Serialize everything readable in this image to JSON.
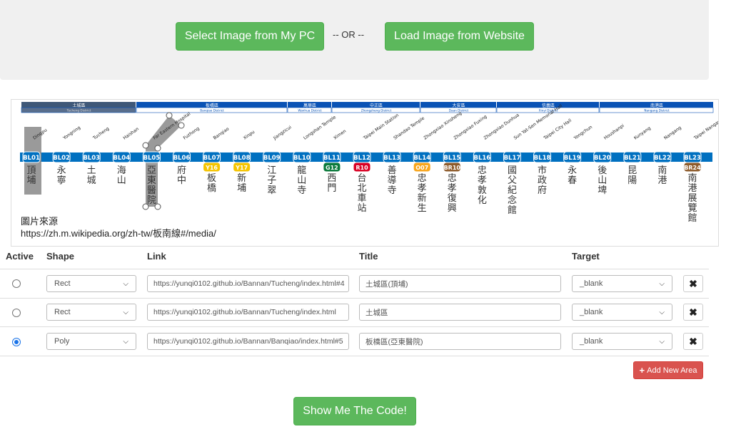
{
  "toolbar": {
    "select_pc_label": "Select Image from My PC",
    "or_label": "-- OR --",
    "load_web_label": "Load Image from Website",
    "show_code_label": "Show Me The Code!"
  },
  "map": {
    "districts": [
      {
        "name": "土城區",
        "en": "Tucheng District",
        "highlight": true
      },
      {
        "name": "板橋區",
        "en": "Banqiao District",
        "highlight": false
      },
      {
        "name": "萬華區",
        "en": "Wanhua District",
        "highlight": false
      },
      {
        "name": "中正區",
        "en": "Zhongzheng District",
        "highlight": false
      },
      {
        "name": "大安區",
        "en": "Daan District",
        "highlight": false
      },
      {
        "name": "信義區",
        "en": "Xinyi District",
        "highlight": false
      },
      {
        "name": "南港區",
        "en": "Nangang District",
        "highlight": false
      }
    ],
    "stations": [
      {
        "code": "BL01",
        "zh": "頂埔",
        "en": "Dingpu"
      },
      {
        "code": "BL02",
        "zh": "永寧",
        "en": "Yongning"
      },
      {
        "code": "BL03",
        "zh": "土城",
        "en": "Tucheng"
      },
      {
        "code": "BL04",
        "zh": "海山",
        "en": "Haishan"
      },
      {
        "code": "BL05",
        "zh": "亞東醫院",
        "en": "Far Eastern Hospital"
      },
      {
        "code": "BL06",
        "zh": "府中",
        "en": "Fuzhong"
      },
      {
        "code": "BL07",
        "zh": "板橋",
        "en": "Banqiao",
        "transfer": "Y16",
        "tcolor": "#f5c400"
      },
      {
        "code": "BL08",
        "zh": "新埔",
        "en": "Xinpu",
        "transfer": "Y17",
        "tcolor": "#f5c400"
      },
      {
        "code": "BL09",
        "zh": "江子翠",
        "en": "Jiangzicui"
      },
      {
        "code": "BL10",
        "zh": "龍山寺",
        "en": "Longshan Temple"
      },
      {
        "code": "BL11",
        "zh": "西門",
        "en": "Ximen",
        "transfer": "G12",
        "tcolor": "#0a7a3b"
      },
      {
        "code": "BL12",
        "zh": "台北車站",
        "en": "Taipei Main Station",
        "transfer": "R10",
        "tcolor": "#d90023"
      },
      {
        "code": "BL13",
        "zh": "善導寺",
        "en": "Shandao Temple"
      },
      {
        "code": "BL14",
        "zh": "忠孝新生",
        "en": "Zhongxiao Xinsheng",
        "transfer": "O07",
        "tcolor": "#f8a51b"
      },
      {
        "code": "BL15",
        "zh": "忠孝復興",
        "en": "Zhongxiao Fuxing",
        "transfer": "BR10",
        "tcolor": "#8e5b2b"
      },
      {
        "code": "BL16",
        "zh": "忠孝敦化",
        "en": "Zhongxiao Dunhua"
      },
      {
        "code": "BL17",
        "zh": "國父紀念館",
        "en": "Sun Yat-Sen Memorial Hall"
      },
      {
        "code": "BL18",
        "zh": "市政府",
        "en": "Taipei City Hall"
      },
      {
        "code": "BL19",
        "zh": "永春",
        "en": "Yongchun"
      },
      {
        "code": "BL20",
        "zh": "後山埤",
        "en": "Houshanpi"
      },
      {
        "code": "BL21",
        "zh": "昆陽",
        "en": "Kunyang"
      },
      {
        "code": "BL22",
        "zh": "南港",
        "en": "Nangang"
      },
      {
        "code": "BL23",
        "zh": "南港展覽館",
        "en": "Taipei Nangang Exhibition Center",
        "transfer": "BR24",
        "tcolor": "#8e5b2b"
      }
    ],
    "source_label": "圖片來源",
    "source_url": "https://zh.m.wikipedia.org/zh-tw/板南線#/media/",
    "line_color": "#0070c0"
  },
  "table": {
    "headers": {
      "active": "Active",
      "shape": "Shape",
      "link": "Link",
      "title": "Title",
      "target": "Target"
    },
    "rows": [
      {
        "active": false,
        "shape": "Rect",
        "link": "https://yunqi0102.github.io/Bannan/Tucheng/index.html#4",
        "title": "土城區(頂埔)",
        "target": "_blank"
      },
      {
        "active": false,
        "shape": "Rect",
        "link": "https://yunqi0102.github.io/Bannan/Tucheng/index.html",
        "title": "土城區",
        "target": "_blank"
      },
      {
        "active": true,
        "shape": "Poly",
        "link": "https://yunqi0102.github.io/Bannan/Banqiao/index.html#5",
        "title": "板橋區(亞東醫院)",
        "target": "_blank"
      }
    ],
    "delete_icon": "✖",
    "add_label": "Add New Area",
    "add_icon": "plus-icon"
  }
}
